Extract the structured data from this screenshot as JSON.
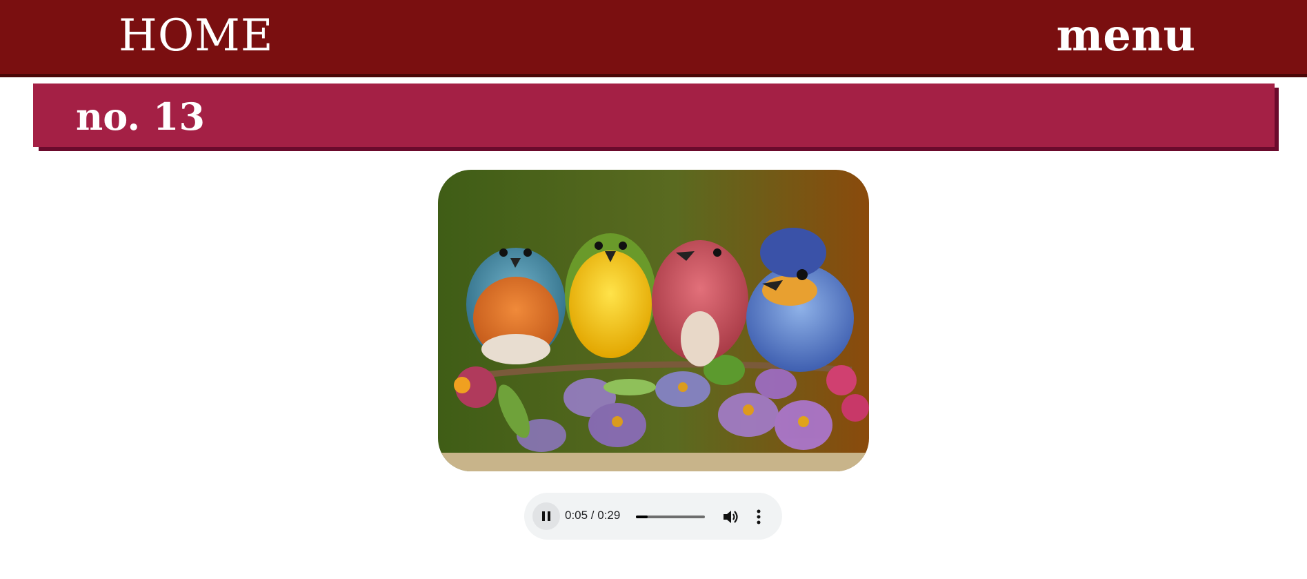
{
  "nav": {
    "home_label": "HOME",
    "menu_label": "menu"
  },
  "page": {
    "title": "no. 13"
  },
  "picture": {
    "subject": "four colorful birds perched on a flowering branch",
    "birds": [
      "teal-orange bird",
      "yellow bird",
      "red bird",
      "blue bird"
    ]
  },
  "audio_player": {
    "state": "playing",
    "time_display": "0:05 / 0:29",
    "current_seconds": 5,
    "duration_seconds": 29,
    "progress_fraction": 0.172,
    "play_pause_icon": "pause-icon",
    "volume_icon": "volume-icon",
    "more_icon": "more-vert-icon"
  },
  "colors": {
    "topbar": "#7a0f10",
    "title_band": "#a42045",
    "title_shadow": "#6b0a2c",
    "player_bg": "#f1f3f4"
  }
}
